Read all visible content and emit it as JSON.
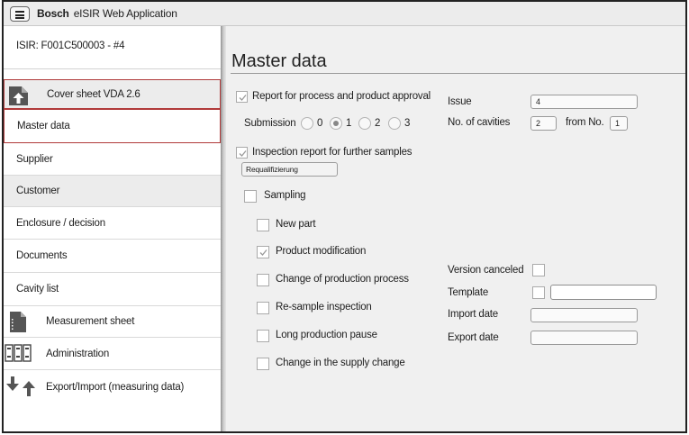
{
  "app": {
    "brand": "Bosch",
    "title": "eISIR Web Application"
  },
  "sidebar": {
    "header": "ISIR: F001C500003 - #4",
    "items": [
      {
        "label": "Cover sheet VDA 2.6",
        "icon": "document-upload-icon"
      },
      {
        "label": "Master data"
      },
      {
        "label": "Supplier"
      },
      {
        "label": "Customer"
      },
      {
        "label": "Enclosure / decision"
      },
      {
        "label": "Documents"
      },
      {
        "label": "Cavity list"
      },
      {
        "label": "Measurement sheet",
        "icon": "measurement-sheet-icon"
      },
      {
        "label": "Administration",
        "icon": "administration-icon"
      },
      {
        "label": "Export/Import (measuring data)",
        "icon": "export-import-icon"
      }
    ]
  },
  "main": {
    "title": "Master data",
    "report_process_label": "Report for process and product approval",
    "submission_label": "Submission",
    "submission_options": [
      "0",
      "1",
      "2",
      "3"
    ],
    "submission_selected": "1",
    "inspection_report_label": "Inspection report for further samples",
    "requalification_button": "Requalifizierung",
    "sampling_label": "Sampling",
    "options": {
      "new_part": "New part",
      "product_modification": "Product modification",
      "change_process": "Change of production process",
      "resample": "Re-sample inspection",
      "long_pause": "Long production pause",
      "supply_change": "Change in the supply change"
    },
    "issue_label": "Issue",
    "issue_value": "4",
    "cavities_label": "No. of cavities",
    "cavities_value": "2",
    "from_no_label": "from No.",
    "from_no_value": "1",
    "version_canceled_label": "Version canceled",
    "template_label": "Template",
    "template_value": "",
    "import_date_label": "Import date",
    "import_date_value": "",
    "export_date_label": "Export date",
    "export_date_value": ""
  },
  "colors": {
    "selected_border": "#b03a3a",
    "panel_bg": "#f0f0f0",
    "titlebar_bg": "#ececec"
  }
}
